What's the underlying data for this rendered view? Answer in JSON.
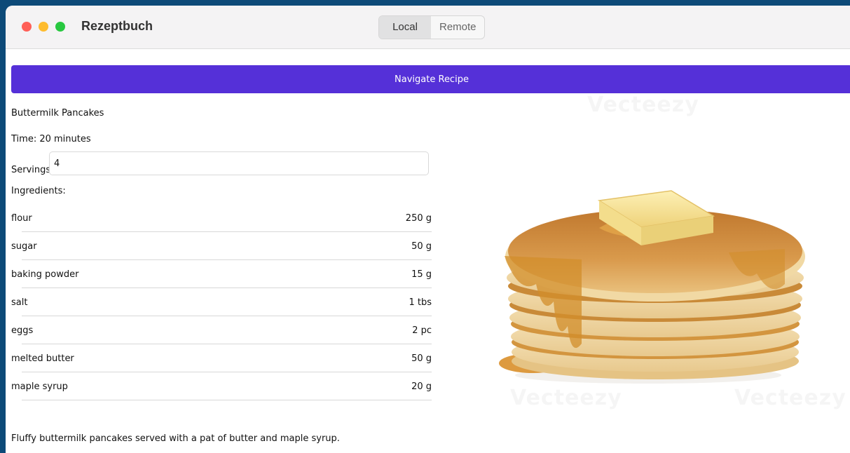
{
  "window": {
    "title": "Rezeptbuch",
    "tabs": [
      {
        "label": "Local",
        "active": true
      },
      {
        "label": "Remote",
        "active": false
      }
    ]
  },
  "navigate_button": {
    "label": "Navigate Recipe",
    "color": "#5530d8"
  },
  "recipe": {
    "name": "Buttermilk Pancakes",
    "time": "Time: 20 minutes",
    "servings_label": "Servings:",
    "servings_value": "4",
    "ingredients_label": "Ingredients:",
    "ingredients": [
      {
        "name": "flour",
        "qty": "250 g"
      },
      {
        "name": "sugar",
        "qty": "50 g"
      },
      {
        "name": "baking powder",
        "qty": "15 g"
      },
      {
        "name": "salt",
        "qty": "1 tbs"
      },
      {
        "name": "eggs",
        "qty": "2 pc"
      },
      {
        "name": "melted butter",
        "qty": "50 g"
      },
      {
        "name": "maple syrup",
        "qty": "20 g"
      }
    ],
    "description": "Fluffy buttermilk pancakes served with a pat of butter and maple syrup."
  },
  "watermark": "Vecteezy"
}
